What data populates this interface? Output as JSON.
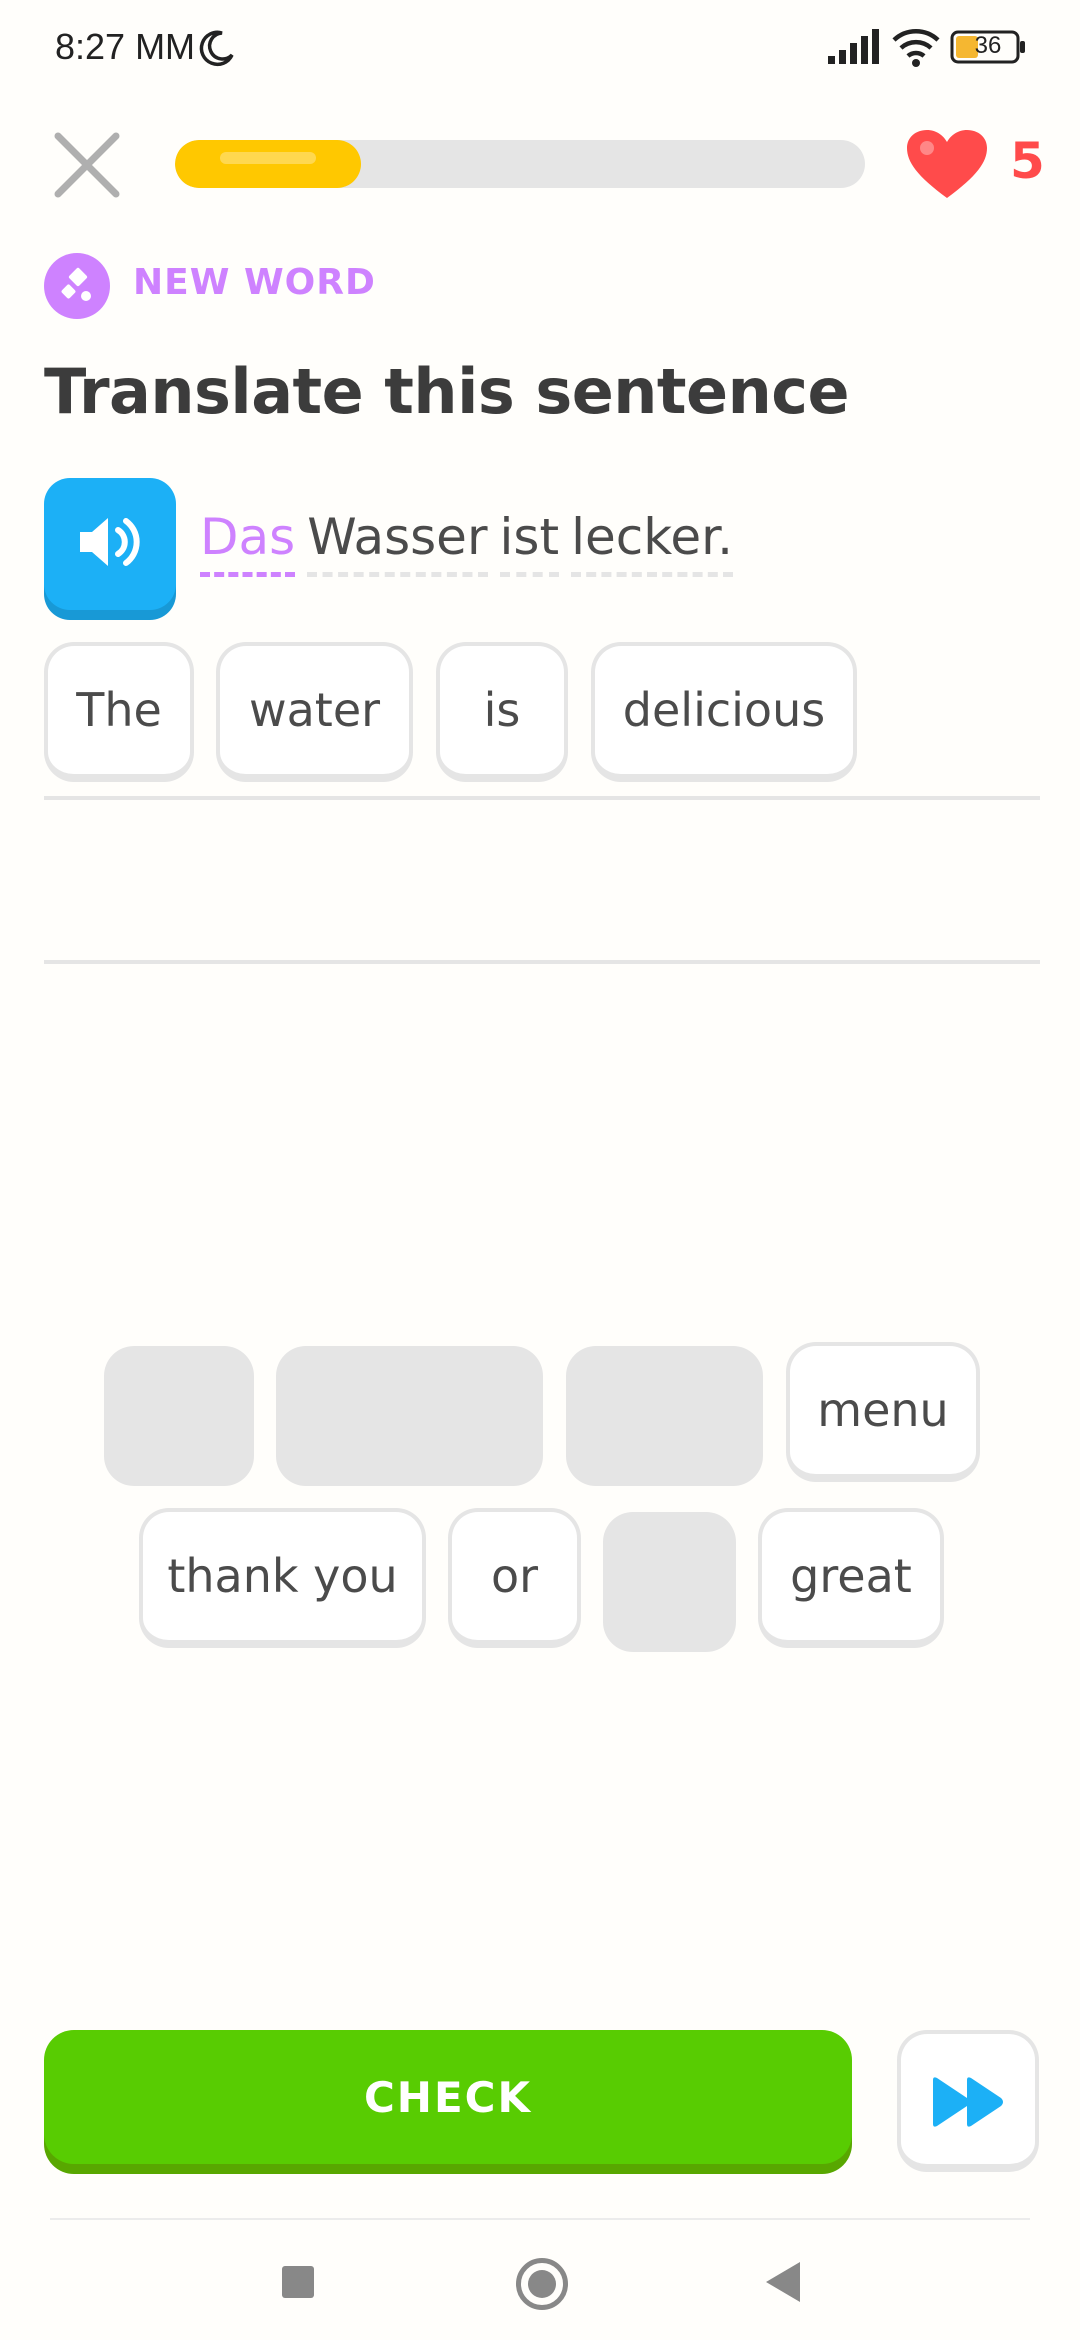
{
  "status_bar": {
    "time": "8:27 MM",
    "battery": "36",
    "icons": [
      "moon-icon",
      "signal-icon",
      "wifi-icon",
      "battery-icon"
    ]
  },
  "header": {
    "close_icon": "close-icon",
    "progress_fraction": 0.27,
    "hearts": "5",
    "heart_color": "#ff4b4b",
    "progress_color": "#ffc800"
  },
  "lesson": {
    "badge_label": "NEW WORD",
    "badge_color": "#ce82ff",
    "title": "Translate this sentence",
    "speaker_icon": "speaker-icon",
    "sentence_words": [
      {
        "text": "Das",
        "is_new": true
      },
      {
        "text": "Wasser",
        "is_new": false
      },
      {
        "text": "ist",
        "is_new": false
      },
      {
        "text": "lecker.",
        "is_new": false
      }
    ]
  },
  "answer_tiles": [
    "The",
    "water",
    "is",
    "delicious"
  ],
  "word_bank": {
    "row1": [
      {
        "text": "",
        "used": true
      },
      {
        "text": "",
        "used": true
      },
      {
        "text": "",
        "used": true
      },
      {
        "text": "menu",
        "used": false
      }
    ],
    "row2": [
      {
        "text": "thank you",
        "used": false
      },
      {
        "text": "or",
        "used": false
      },
      {
        "text": "",
        "used": true
      },
      {
        "text": "great",
        "used": false
      }
    ]
  },
  "footer": {
    "check_label": "CHECK",
    "check_color": "#58cc02",
    "skip_icon": "fast-forward-icon"
  },
  "navigation_bar": {
    "icons": [
      "recents-square-icon",
      "home-circle-icon",
      "back-triangle-icon"
    ]
  }
}
